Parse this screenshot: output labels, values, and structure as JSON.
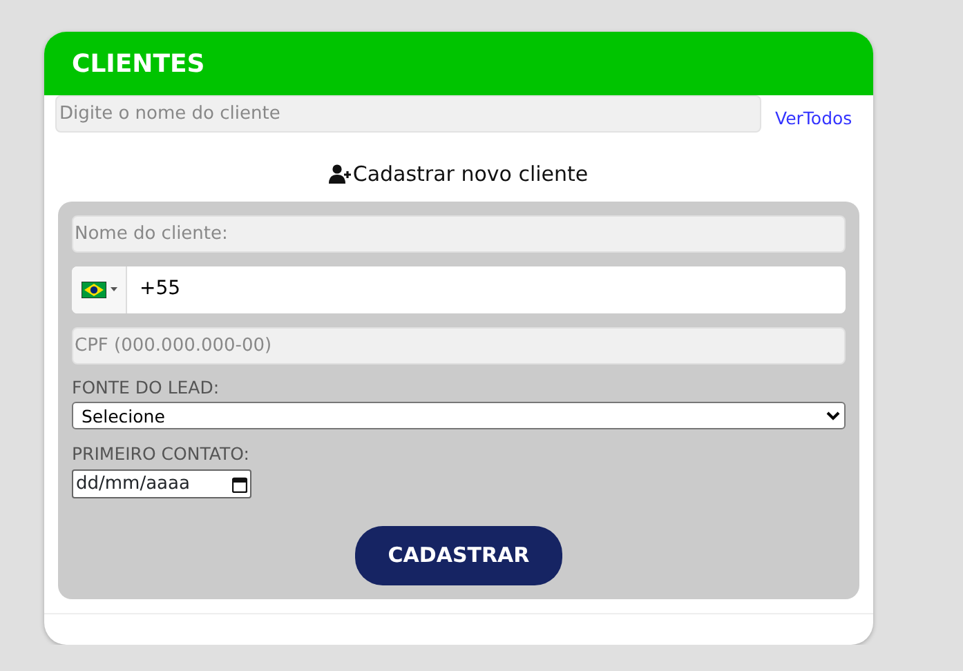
{
  "header": {
    "title": "CLIENTES"
  },
  "search": {
    "placeholder": "Digite o nome do cliente"
  },
  "view_all_link": "VerTodos",
  "form_title": "Cadastrar novo cliente",
  "form": {
    "fields": [
      {
        "kind": "text",
        "placeholder": "Nome do cliente:"
      },
      {
        "kind": "phone",
        "value": "+55"
      },
      {
        "kind": "text",
        "placeholder": "CPF (000.000.000-00)"
      },
      {
        "kind": "select",
        "label": "FONTE DO LEAD:",
        "value": "Selecione"
      },
      {
        "kind": "date",
        "label": "PRIMEIRO CONTATO:",
        "value": "dd/mm/aaaa"
      }
    ],
    "submit": "CADASTRAR"
  }
}
